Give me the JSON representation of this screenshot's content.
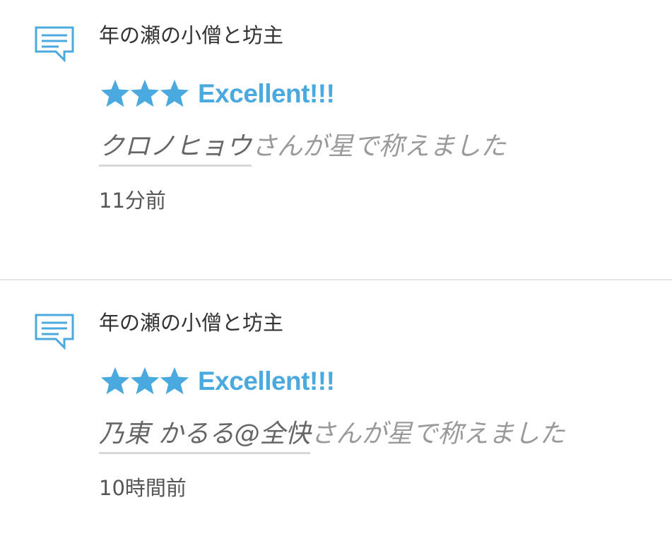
{
  "colors": {
    "accent": "#4aa9de",
    "title_text": "#333333",
    "user_text": "#666666",
    "suffix_text": "#9a9a9a",
    "divider": "#e3e3e3"
  },
  "notifications": [
    {
      "icon": "comment-icon",
      "post_title": "年の瀬の小僧と坊主",
      "stars": 3,
      "rating_label": "Excellent!!!",
      "user_name": "クロノヒョウ",
      "praise_suffix": "さんが星で称えました",
      "time_ago": "11分前"
    },
    {
      "icon": "comment-icon",
      "post_title": "年の瀬の小僧と坊主",
      "stars": 3,
      "rating_label": "Excellent!!!",
      "user_name": "乃東 かるる@全快",
      "praise_suffix": "さんが星で称えました",
      "time_ago": "10時間前"
    }
  ]
}
